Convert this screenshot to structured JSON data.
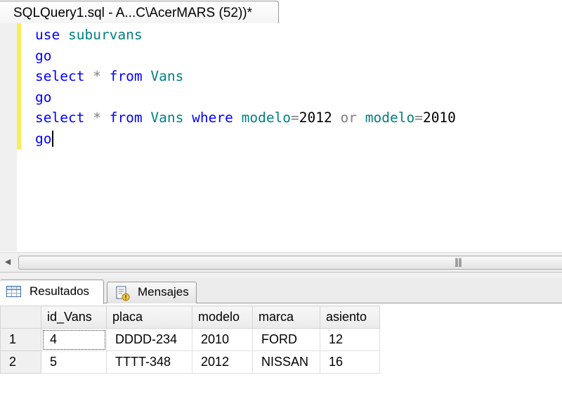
{
  "document_tab": {
    "title": "SQLQuery1.sql - A...C\\AcerMARS (52))*"
  },
  "editor": {
    "lines": [
      [
        {
          "t": "use",
          "c": "kw"
        },
        {
          "t": " ",
          "c": "sp"
        },
        {
          "t": "suburvans",
          "c": "id"
        }
      ],
      [
        {
          "t": "go",
          "c": "kw"
        }
      ],
      [
        {
          "t": "select",
          "c": "kw"
        },
        {
          "t": " ",
          "c": "sp"
        },
        {
          "t": "*",
          "c": "op"
        },
        {
          "t": " ",
          "c": "sp"
        },
        {
          "t": "from",
          "c": "kw"
        },
        {
          "t": " ",
          "c": "sp"
        },
        {
          "t": "Vans",
          "c": "id"
        }
      ],
      [
        {
          "t": "go",
          "c": "kw"
        }
      ],
      [
        {
          "t": "select",
          "c": "kw"
        },
        {
          "t": " ",
          "c": "sp"
        },
        {
          "t": "*",
          "c": "op"
        },
        {
          "t": " ",
          "c": "sp"
        },
        {
          "t": "from",
          "c": "kw"
        },
        {
          "t": " ",
          "c": "sp"
        },
        {
          "t": "Vans",
          "c": "id"
        },
        {
          "t": " ",
          "c": "sp"
        },
        {
          "t": "where",
          "c": "kw"
        },
        {
          "t": " ",
          "c": "sp"
        },
        {
          "t": "modelo",
          "c": "id"
        },
        {
          "t": "=",
          "c": "op"
        },
        {
          "t": "2012",
          "c": "num"
        },
        {
          "t": " ",
          "c": "sp"
        },
        {
          "t": "or",
          "c": "op"
        },
        {
          "t": " ",
          "c": "sp"
        },
        {
          "t": "modelo",
          "c": "id"
        },
        {
          "t": "=",
          "c": "op"
        },
        {
          "t": "2010",
          "c": "num"
        }
      ],
      [
        {
          "t": "go",
          "c": "kw"
        }
      ]
    ],
    "colors": {
      "keyword": "#0000ff",
      "identifier": "#008080",
      "operator": "#808080",
      "changed_line_marker": "#f8ed58"
    }
  },
  "scrollbar": {
    "left_arrow_icon": "arrow-left-icon",
    "grip_icon": "grip-icon"
  },
  "result_tabs": [
    {
      "label": "Resultados",
      "icon": "grid-icon",
      "active": true
    },
    {
      "label": "Mensajes",
      "icon": "messages-icon",
      "active": false
    }
  ],
  "results": {
    "columns": [
      "id_Vans",
      "placa",
      "modelo",
      "marca",
      "asiento"
    ],
    "rows": [
      {
        "row_number": "1",
        "cells": [
          "4",
          "DDDD-234",
          "2010",
          "FORD",
          "12"
        ]
      },
      {
        "row_number": "2",
        "cells": [
          "5",
          "TTTT-348",
          "2012",
          "NISSAN",
          "16"
        ]
      }
    ]
  }
}
